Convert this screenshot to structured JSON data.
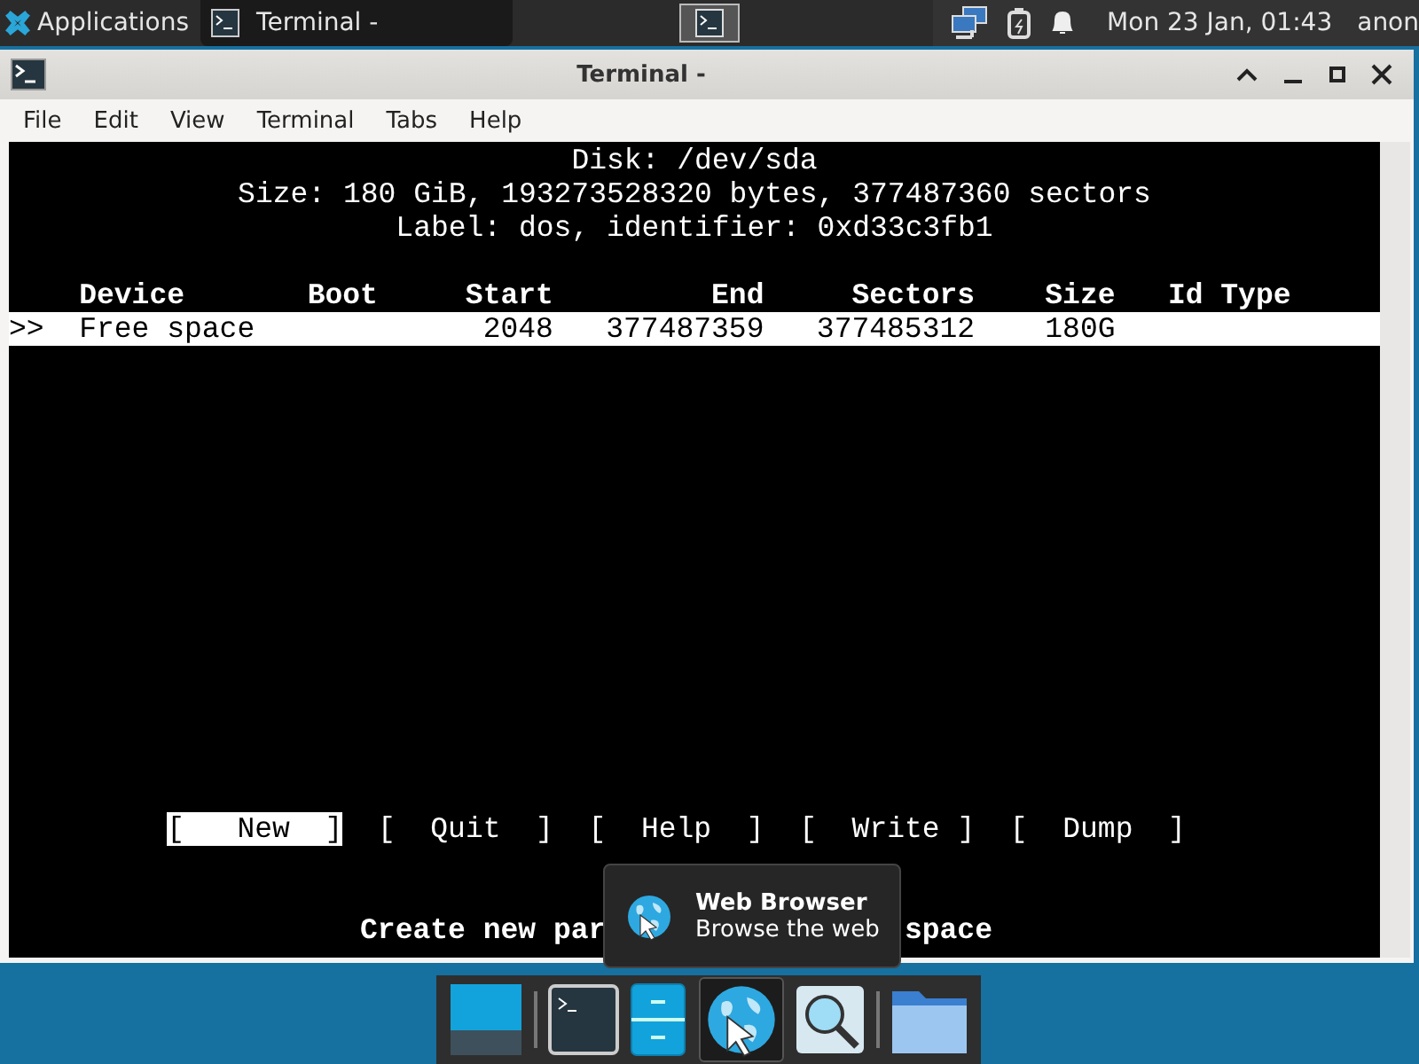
{
  "top_panel": {
    "apps_menu": "Applications",
    "tasks": [
      {
        "title": "Terminal -",
        "selected": true
      }
    ],
    "clock": "Mon 23 Jan, 01:43",
    "user": "anon"
  },
  "window": {
    "title": "Terminal -",
    "menu": [
      "File",
      "Edit",
      "View",
      "Terminal",
      "Tabs",
      "Help"
    ]
  },
  "terminal": {
    "disk_title": "Disk: /dev/sda",
    "size_line": "Size: 180 GiB, 193273528320 bytes, 377487360 sectors",
    "label_line": "Label: dos, identifier: 0xd33c3fb1",
    "columns": [
      "Device",
      "Boot",
      "Start",
      "End",
      "Sectors",
      "Size",
      "Id Type"
    ],
    "rows": [
      {
        "marker": ">>",
        "device": "Free space",
        "start": "2048",
        "end": "377487359",
        "sectors": "377485312",
        "size": "180G",
        "selected": true
      }
    ],
    "actions": [
      {
        "label": "[   New  ]",
        "selected": true
      },
      {
        "label": "[  Quit  ]",
        "selected": false
      },
      {
        "label": "[  Help  ]",
        "selected": false
      },
      {
        "label": "[  Write ]",
        "selected": false
      },
      {
        "label": "[  Dump  ]",
        "selected": false
      }
    ],
    "status_parts": [
      "Create new par",
      "space"
    ]
  },
  "tooltip": {
    "title": "Web Browser",
    "subtitle": "Browse the web"
  }
}
